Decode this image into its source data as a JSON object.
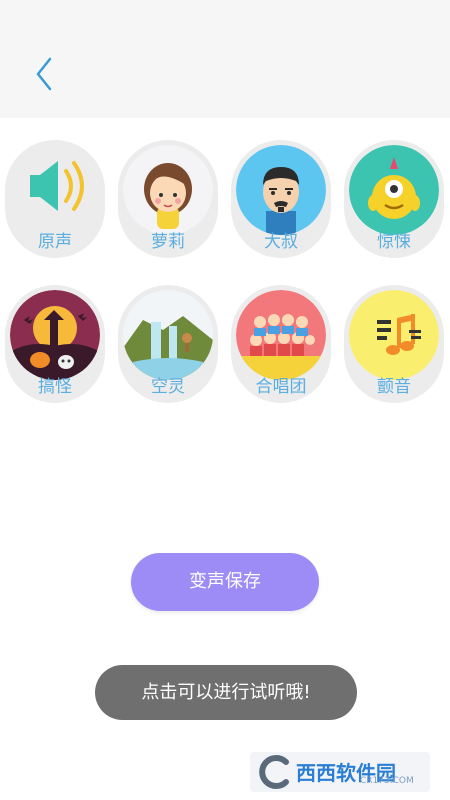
{
  "header": {
    "back_icon": "chevron-left-icon",
    "accent_color": "#3a9ad9"
  },
  "effects": [
    {
      "label": "原声",
      "icon": "speaker-icon"
    },
    {
      "label": "萝莉",
      "icon": "girl-avatar-icon"
    },
    {
      "label": "大叔",
      "icon": "uncle-avatar-icon"
    },
    {
      "label": "惊悚",
      "icon": "monster-icon"
    },
    {
      "label": "搞怪",
      "icon": "halloween-icon"
    },
    {
      "label": "空灵",
      "icon": "waterfall-icon"
    },
    {
      "label": "合唱团",
      "icon": "choir-icon"
    },
    {
      "label": "颤音",
      "icon": "music-note-icon"
    }
  ],
  "save_button": {
    "label": "变声保存",
    "color": "#9d8cf6"
  },
  "toast": {
    "text": "点击可以进行试听哦!"
  },
  "watermark": {
    "text": "西西软件园",
    "sub": "CR173.COM"
  }
}
